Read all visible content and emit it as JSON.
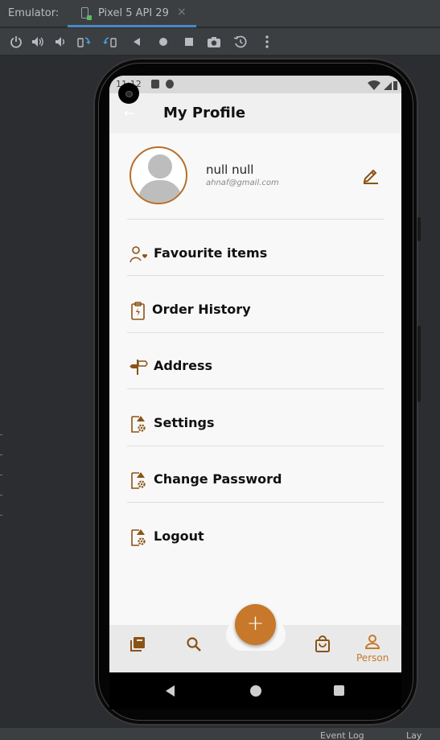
{
  "ide": {
    "emulator_label": "Emulator:",
    "device_tab": "Pixel 5 API 29",
    "tab_close": "×",
    "toolbar_icons": [
      "power-icon",
      "volume-up-icon",
      "volume-down-icon",
      "rotate-left-icon",
      "rotate-right-icon",
      "back-icon",
      "home-icon",
      "overview-icon",
      "screenshot-icon",
      "snapshot-icon",
      "more-icon"
    ],
    "footer": {
      "event_log": "Event Log",
      "layout": "Lay"
    }
  },
  "device": {
    "status_time": "11:12",
    "screen": {
      "title": "My Profile",
      "back_icon": "←",
      "profile": {
        "name": "null null",
        "email": "ahnaf@gmail.com"
      },
      "menu": [
        {
          "label": "Favourite items",
          "icon": "person-heart-icon"
        },
        {
          "label": "Order History",
          "icon": "clipboard-bolt-icon"
        },
        {
          "label": "Address",
          "icon": "signpost-icon"
        },
        {
          "label": "Settings",
          "icon": "doc-gear-icon"
        },
        {
          "label": "Change Password",
          "icon": "doc-gear-icon"
        },
        {
          "label": "Logout",
          "icon": "doc-gear-icon"
        }
      ],
      "bottom_nav": {
        "fab_label": "+",
        "items": [
          "library-icon",
          "search-icon",
          "bag-icon",
          "person-icon"
        ],
        "active_label": "Person"
      },
      "accent_color": "#c8782b"
    }
  }
}
